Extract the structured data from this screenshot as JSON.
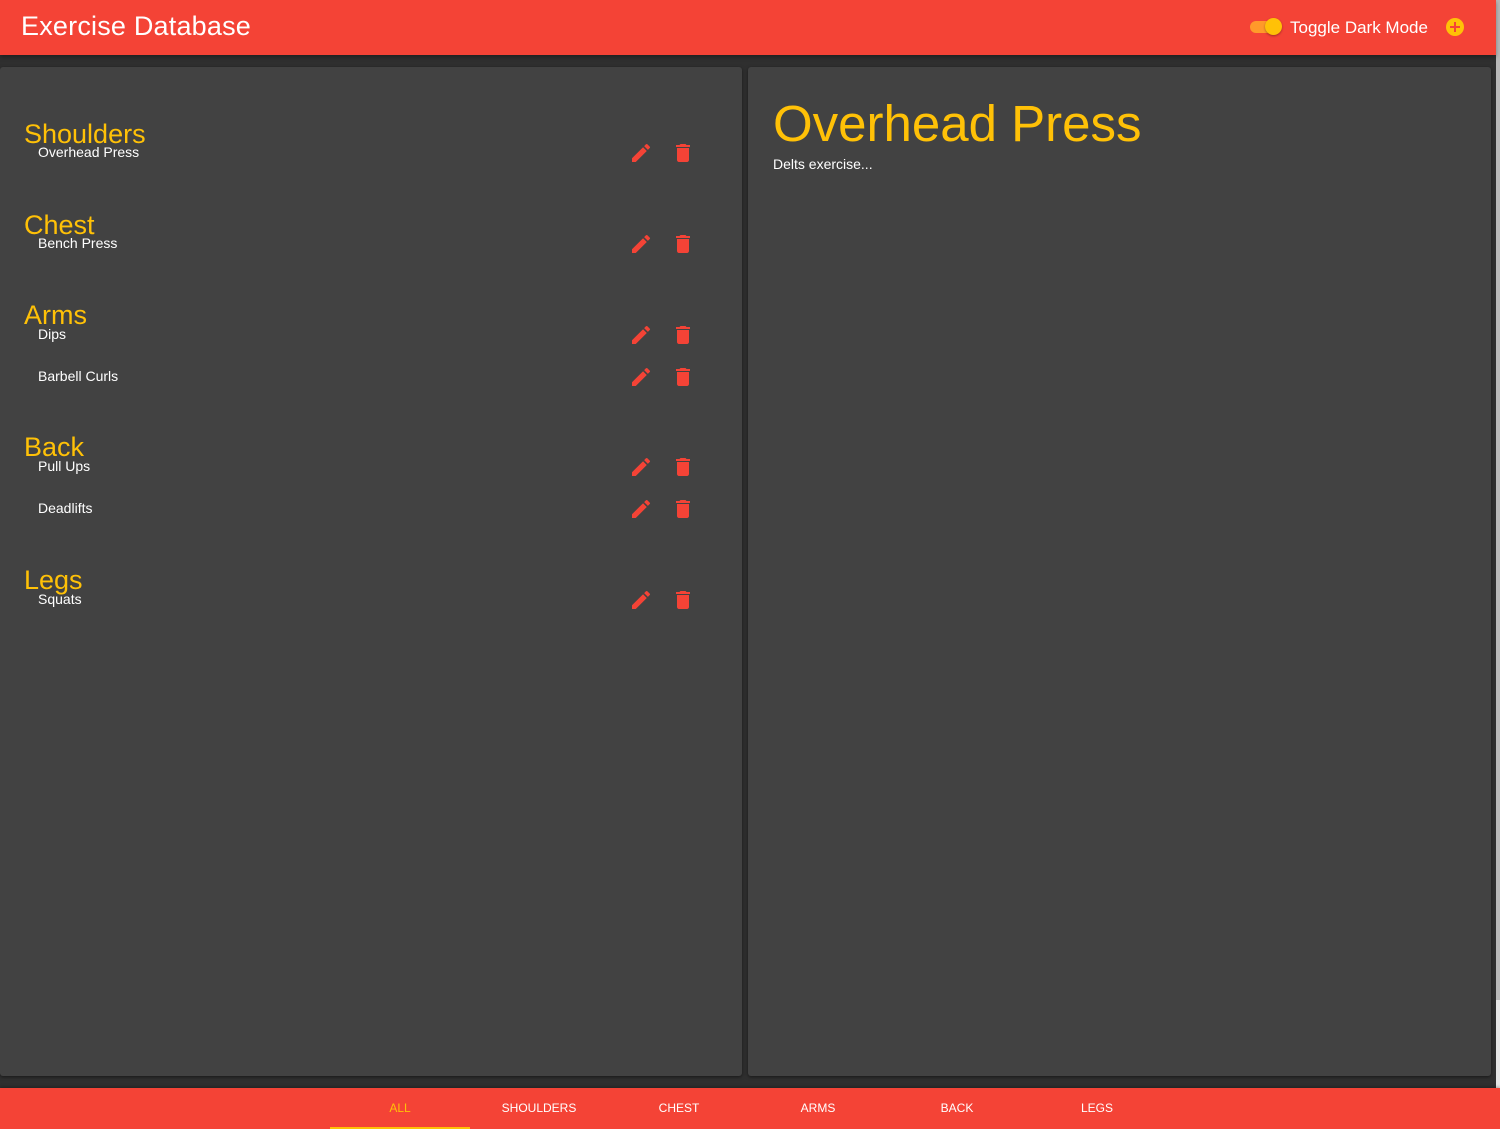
{
  "appbar": {
    "title": "Exercise Database",
    "toggle_label": "Toggle Dark Mode",
    "dark_mode_on": true
  },
  "groups": [
    {
      "title": "Shoulders",
      "exercises": [
        "Overhead Press"
      ]
    },
    {
      "title": "Chest",
      "exercises": [
        "Bench Press"
      ]
    },
    {
      "title": "Arms",
      "exercises": [
        "Dips",
        "Barbell Curls"
      ]
    },
    {
      "title": "Back",
      "exercises": [
        "Pull Ups",
        "Deadlifts"
      ]
    },
    {
      "title": "Legs",
      "exercises": [
        "Squats"
      ]
    }
  ],
  "detail": {
    "title": "Overhead Press",
    "description": "Delts exercise..."
  },
  "tabs": [
    "All",
    "Shoulders",
    "Chest",
    "Arms",
    "Back",
    "Legs"
  ],
  "active_tab": "All",
  "icons": {
    "edit": "pencil-icon",
    "delete": "trash-icon",
    "add": "add-circle-icon"
  },
  "colors": {
    "primary": "#f44336",
    "accent": "#ffc107",
    "panel": "#424242",
    "background": "#2f2f2f"
  }
}
